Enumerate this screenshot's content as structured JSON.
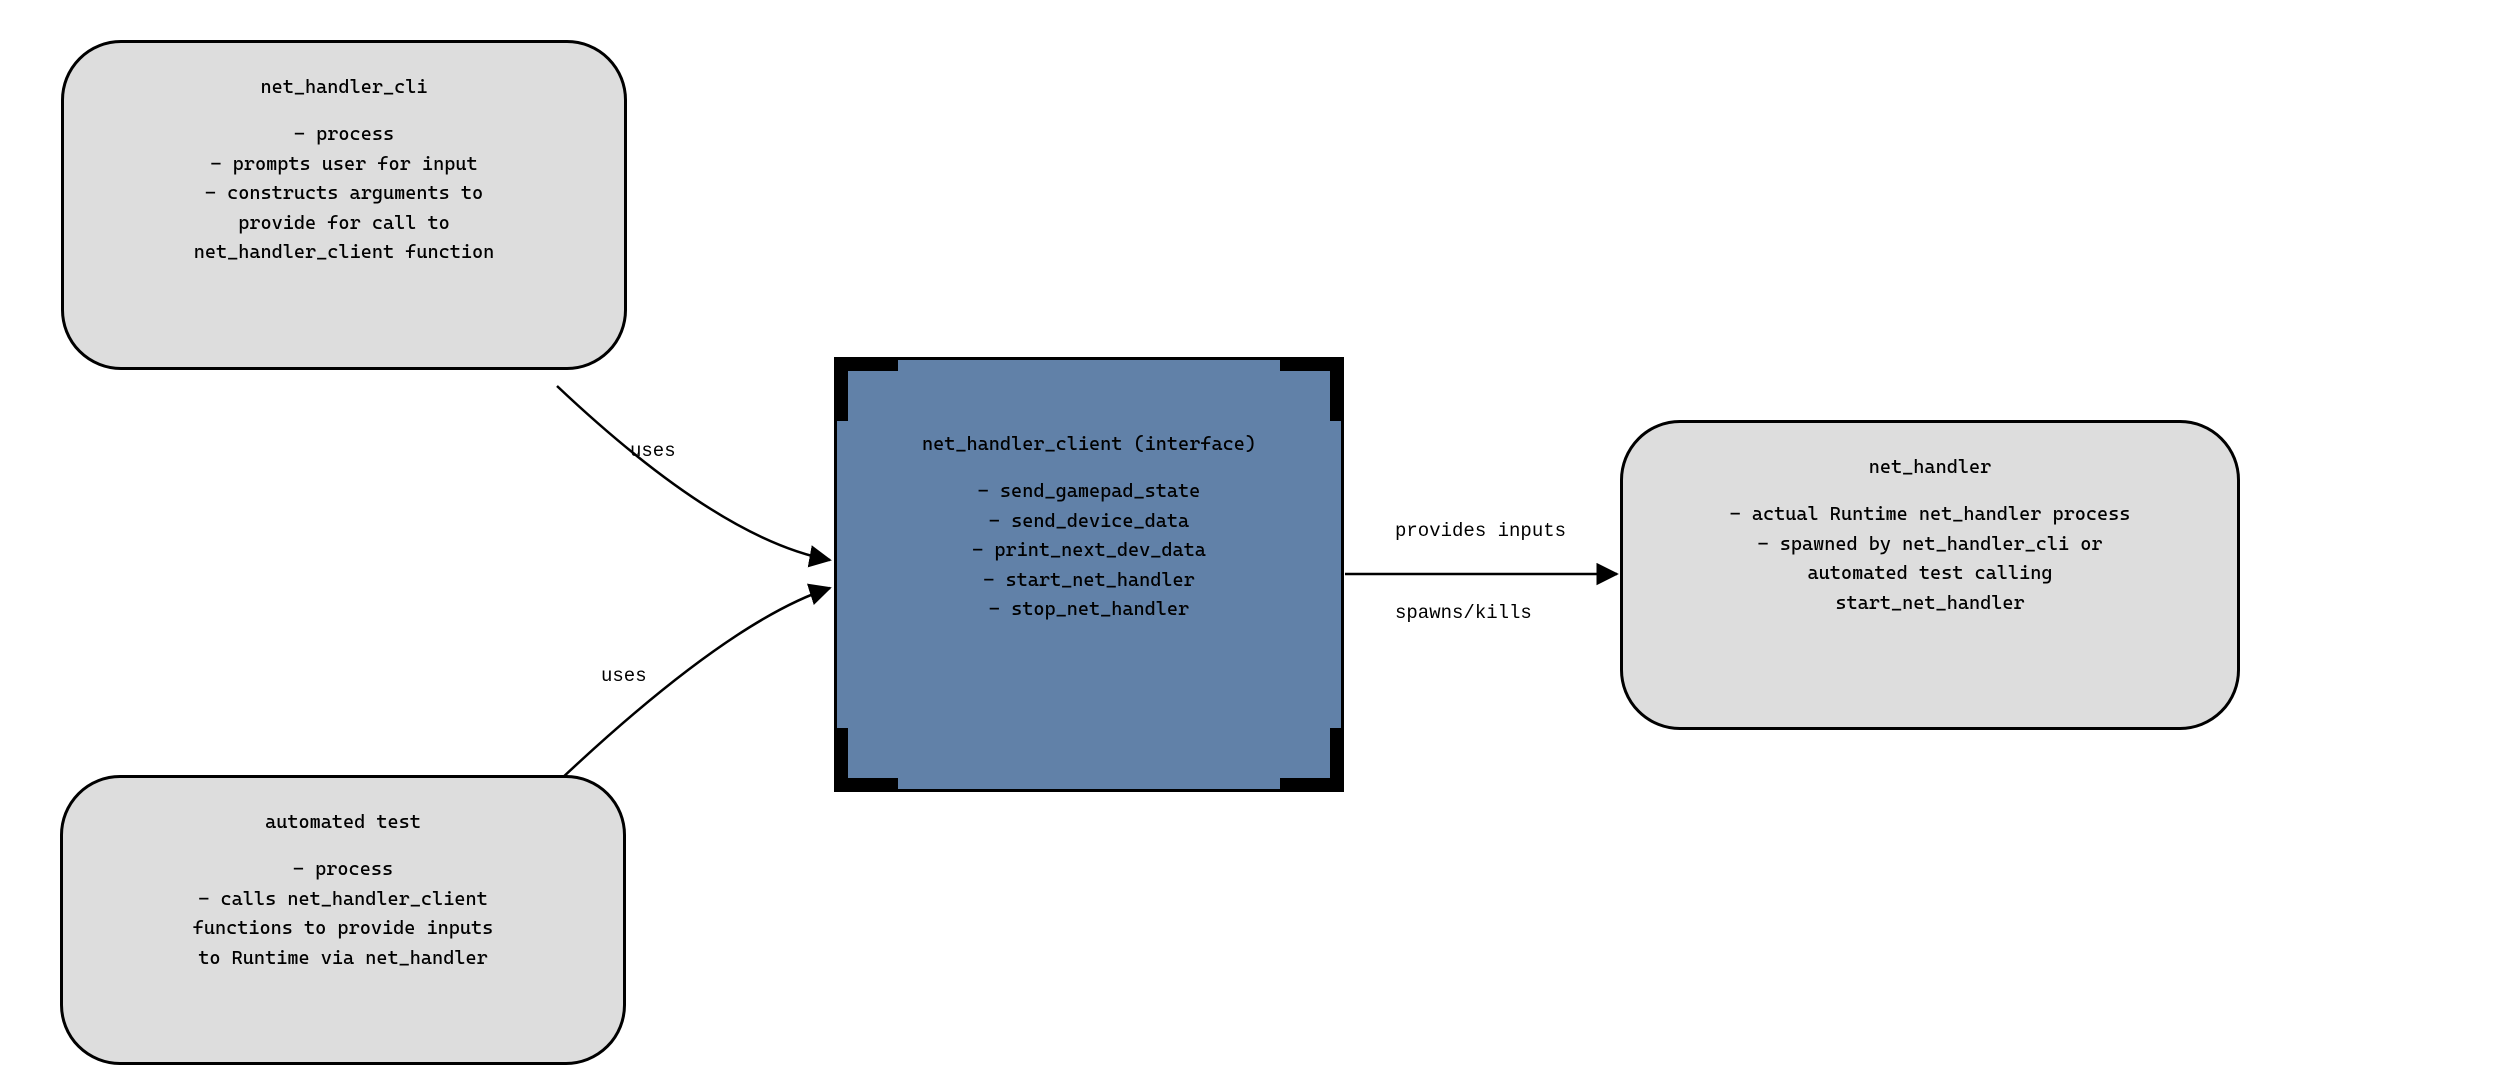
{
  "nodes": {
    "cli": {
      "title": "net_handler_cli",
      "body": "- process\n- prompts user for input\n- constructs arguments to\nprovide for call to\nnet_handler_client function"
    },
    "test": {
      "title": "automated test",
      "body": "- process\n- calls net_handler_client\nfunctions to provide inputs\nto Runtime via net_handler"
    },
    "client": {
      "title": "net_handler_client (interface)",
      "body": "- send_gamepad_state\n- send_device_data\n- print_next_dev_data\n- start_net_handler\n- stop_net_handler"
    },
    "handler": {
      "title": "net_handler",
      "body": "- actual Runtime net_handler process\n- spawned by net_handler_cli or\nautomated test calling\nstart_net_handler"
    }
  },
  "edges": {
    "cli_to_client": "uses",
    "test_to_client": "uses",
    "client_to_handler_top": "provides inputs",
    "client_to_handler_bottom": "spawns/kills"
  }
}
